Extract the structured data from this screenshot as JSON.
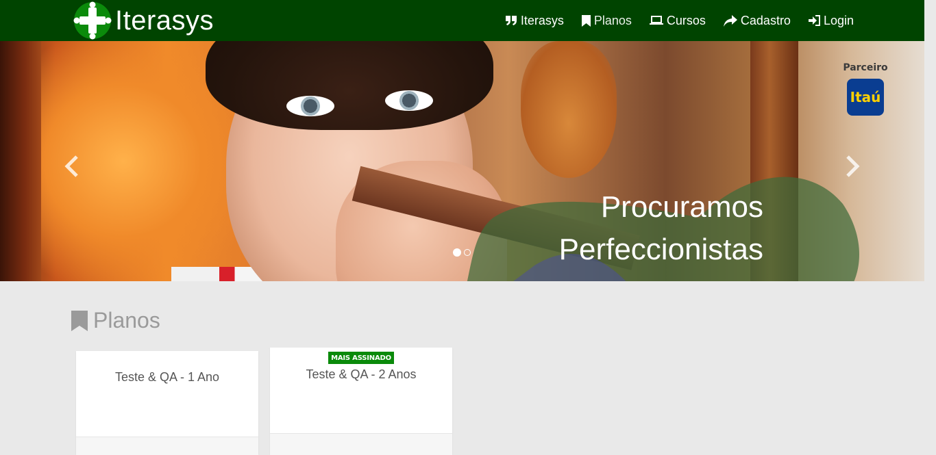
{
  "brand": {
    "name": "Iterasys",
    "icon": "cross-dots-logo-icon",
    "color": "#004400"
  },
  "nav": {
    "items": [
      {
        "label": "Iterasys",
        "icon": "quote-icon"
      },
      {
        "label": "Planos",
        "icon": "bookmark-icon",
        "active": true
      },
      {
        "label": "Cursos",
        "icon": "laptop-icon"
      },
      {
        "label": "Cadastro",
        "icon": "share-arrow-icon"
      },
      {
        "label": "Login",
        "icon": "sign-in-icon"
      }
    ]
  },
  "carousel": {
    "slogan_line1": "Procuramos",
    "slogan_line2": "Perfeccionistas",
    "partner_label": "Parceiro",
    "partner_logo_text": "Itaú",
    "slide_count": 2,
    "active_slide": 1,
    "overlay_color": "#3e6b3a"
  },
  "plans": {
    "title": "Planos",
    "cards": [
      {
        "title": "Teste & QA - 1 Ano",
        "badge": ""
      },
      {
        "title": "Teste & QA - 2 Anos",
        "badge": "MAIS ASSINADO"
      }
    ],
    "badge_color": "#0a8a0a"
  }
}
